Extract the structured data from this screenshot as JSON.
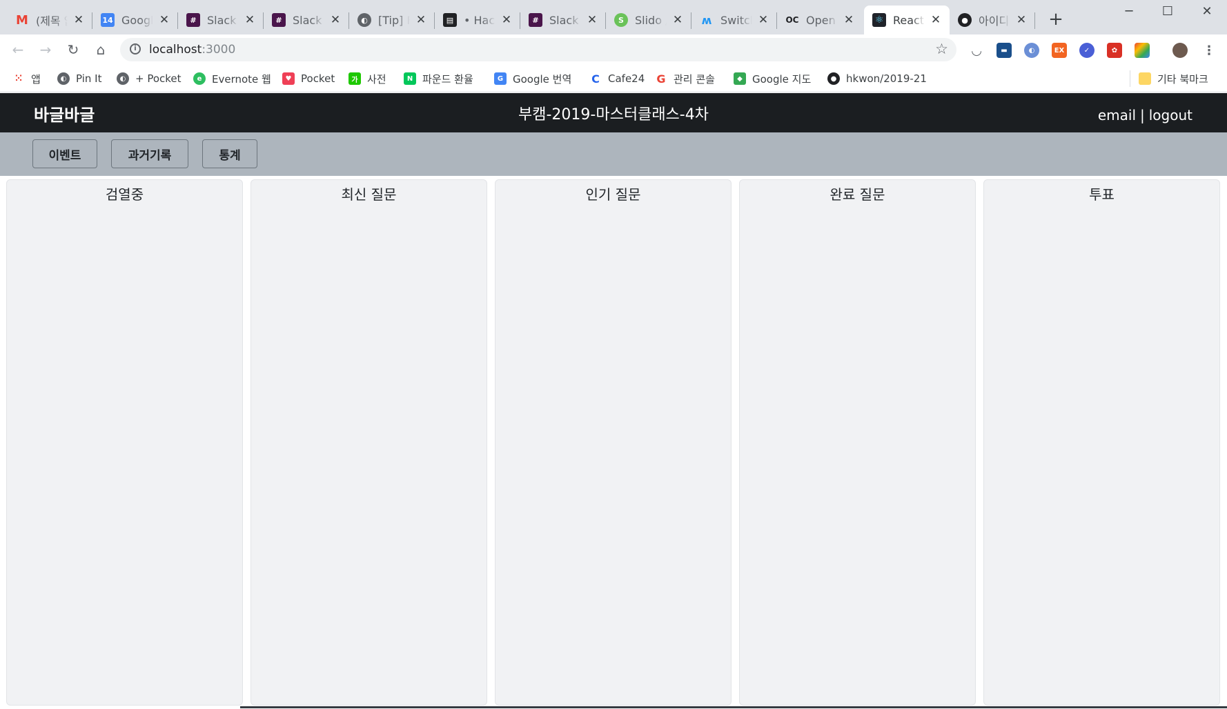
{
  "browser": {
    "tabs": [
      {
        "title": "(제목 없음)",
        "icon": "gmail-icon",
        "color": "#ea4335"
      },
      {
        "title": "Google Calendar",
        "icon": "calendar-icon",
        "color": "#4285f4"
      },
      {
        "title": "Slack | ",
        "icon": "slack-icon",
        "color": "#4a154b"
      },
      {
        "title": "Slack | ",
        "icon": "slack-icon",
        "color": "#4a154b"
      },
      {
        "title": "[Tip] F",
        "icon": "globe-icon",
        "color": "#5f6368"
      },
      {
        "title": "• Hack",
        "icon": "document-icon",
        "color": "#202124"
      },
      {
        "title": "Slack | ",
        "icon": "slack-icon",
        "color": "#4a154b"
      },
      {
        "title": "Slido / ",
        "icon": "slido-icon",
        "color": "#6ac259"
      },
      {
        "title": "Switch",
        "icon": "switch-icon",
        "color": "#2196f3"
      },
      {
        "title": "Open",
        "icon": "oc-icon",
        "color": "#202124"
      },
      {
        "title": "React",
        "icon": "react-icon",
        "color": "#00a8c6",
        "active": true
      },
      {
        "title": "아이디",
        "icon": "github-icon",
        "color": "#202124"
      }
    ],
    "url_host": "localhost",
    "url_port": ":3000",
    "bookmarks": [
      {
        "label": "앱",
        "icon": "apps-grid-icon",
        "color": "#ea4335"
      },
      {
        "label": "Pin It",
        "icon": "globe-icon",
        "color": "#5f6368"
      },
      {
        "label": "+ Pocket",
        "icon": "globe-icon",
        "color": "#5f6368"
      },
      {
        "label": "Evernote 웹",
        "icon": "evernote-icon",
        "color": "#2dbe60"
      },
      {
        "label": "Pocket",
        "icon": "pocket-icon",
        "color": "#ef4056"
      },
      {
        "label": "사전",
        "icon": "dictionary-icon",
        "color": "#1ec800"
      },
      {
        "label": "파운드 환율",
        "icon": "naver-icon",
        "color": "#03c75a"
      },
      {
        "label": "Google 번역",
        "icon": "translate-icon",
        "color": "#4285f4"
      },
      {
        "label": "Cafe24",
        "icon": "cafe24-icon",
        "color": "#2563eb"
      },
      {
        "label": "관리 콘솔",
        "icon": "google-icon",
        "color": "#ea4335"
      },
      {
        "label": "Google 지도",
        "icon": "maps-icon",
        "color": "#34a853"
      },
      {
        "label": "hkwon/2019-21",
        "icon": "github-icon",
        "color": "#202124"
      }
    ],
    "other_bookmarks": "기타 북마크"
  },
  "app": {
    "brand": "바글바글",
    "event_title": "부캠-2019-마스터클래스-4차",
    "user": {
      "email": "email",
      "separator": "|",
      "logout": "logout"
    },
    "nav": {
      "event": "이벤트",
      "history": "과거기록",
      "stats": "통계"
    },
    "columns": {
      "moderation": "검열중",
      "recent": "최신 질문",
      "popular": "인기 질문",
      "completed": "완료 질문",
      "poll": "투표"
    },
    "colors": {
      "header_bg": "#1b1e21",
      "subnav_bg": "#adb5bd",
      "column_bg": "#f1f2f4"
    }
  }
}
